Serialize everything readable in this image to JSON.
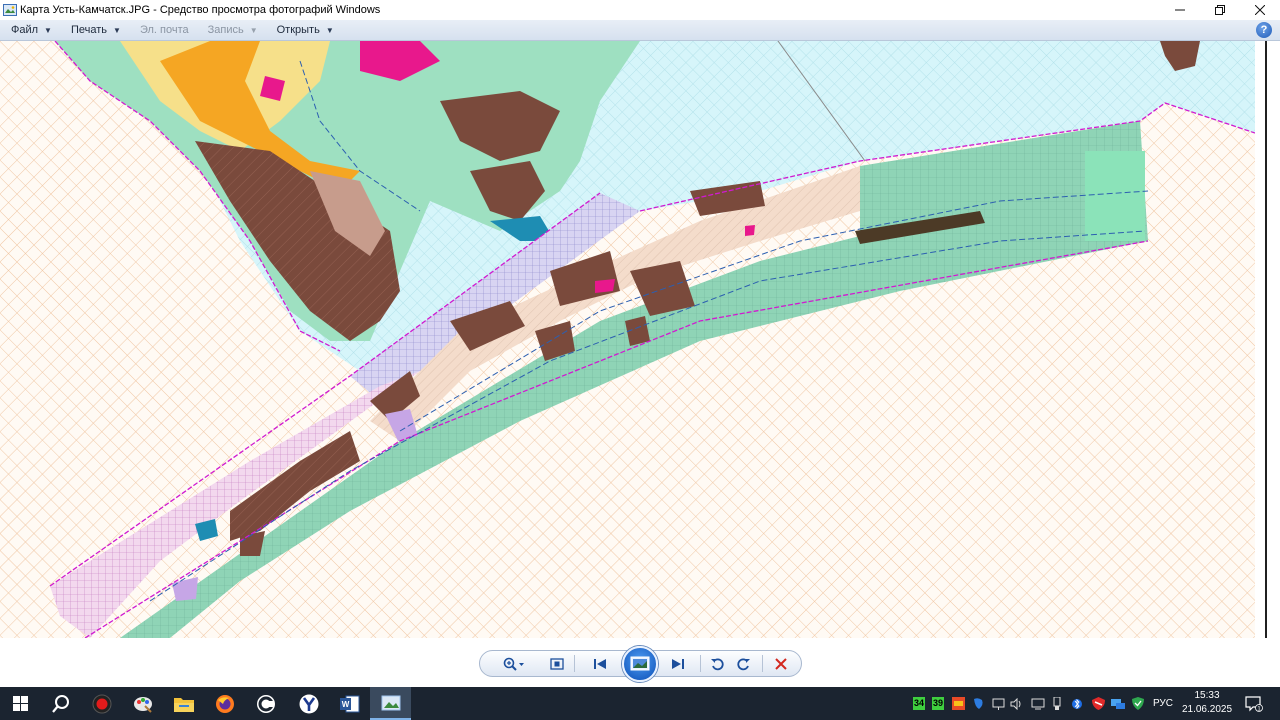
{
  "window": {
    "title": "Карта Усть-Камчатск.JPG - Средство просмотра фотографий Windows",
    "minimize_icon": "minimize-icon",
    "maximize_icon": "restore-icon",
    "close_icon": "close-icon"
  },
  "menu": {
    "items": [
      {
        "label": "Файл",
        "enabled": true
      },
      {
        "label": "Печать",
        "enabled": true
      },
      {
        "label": "Эл. почта",
        "enabled": false
      },
      {
        "label": "Запись",
        "enabled": false
      },
      {
        "label": "Открыть",
        "enabled": true
      }
    ],
    "help_label": "?"
  },
  "image": {
    "description_icon": "zoning-map-image",
    "colors": {
      "water": "#d4f4f8",
      "residential": "#7c4a3b",
      "mixed_zone": "#f3dccb",
      "green_zone": "#87d8b2",
      "commercial": "#f5a623",
      "magenta_zone": "#e8188c",
      "boundary": "#d01ad0",
      "hatch": "#f1c8a6"
    }
  },
  "controls": {
    "zoom_icon": "zoom-icon",
    "fit_icon": "actual-size-icon",
    "prev_icon": "previous-icon",
    "slideshow_icon": "slideshow-icon",
    "next_icon": "next-icon",
    "rotate_left_icon": "rotate-counterclockwise-icon",
    "rotate_right_icon": "rotate-clockwise-icon",
    "delete_icon": "delete-icon"
  },
  "taskbar": {
    "apps": [
      "start-icon",
      "search-icon",
      "record-icon",
      "paint-icon",
      "file-explorer-icon",
      "firefox-icon",
      "browser-icon",
      "yandex-icon",
      "word-icon",
      "photo-viewer-icon"
    ],
    "tray": {
      "badge1": "34",
      "badge2": "39",
      "language": "РУС",
      "time": "15:33",
      "date": "21.06.2025",
      "notifications": "1"
    }
  }
}
